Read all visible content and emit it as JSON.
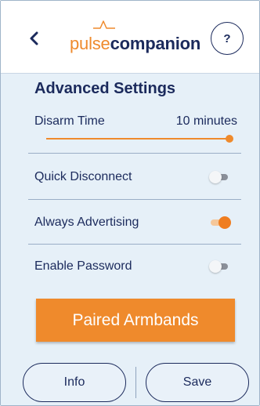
{
  "header": {
    "logo_part1": "pulse",
    "logo_part2": "companion",
    "help_label": "?",
    "icons": {
      "back": "chevron-left-icon",
      "logo_mark": "heartbeat-icon"
    }
  },
  "settings": {
    "title": "Advanced Settings",
    "disarm_time": {
      "label": "Disarm Time",
      "value": "10 minutes",
      "slider_fraction": 1.0
    },
    "toggles": [
      {
        "label": "Quick Disconnect",
        "on": false
      },
      {
        "label": "Always Advertising",
        "on": true
      },
      {
        "label": "Enable Password",
        "on": false
      }
    ]
  },
  "actions": {
    "paired_label": "Paired Armbands",
    "info_label": "Info",
    "save_label": "Save"
  },
  "colors": {
    "accent": "#ef8a2c",
    "navy": "#1b2a5c",
    "panel_bg": "#e6f0f8"
  }
}
